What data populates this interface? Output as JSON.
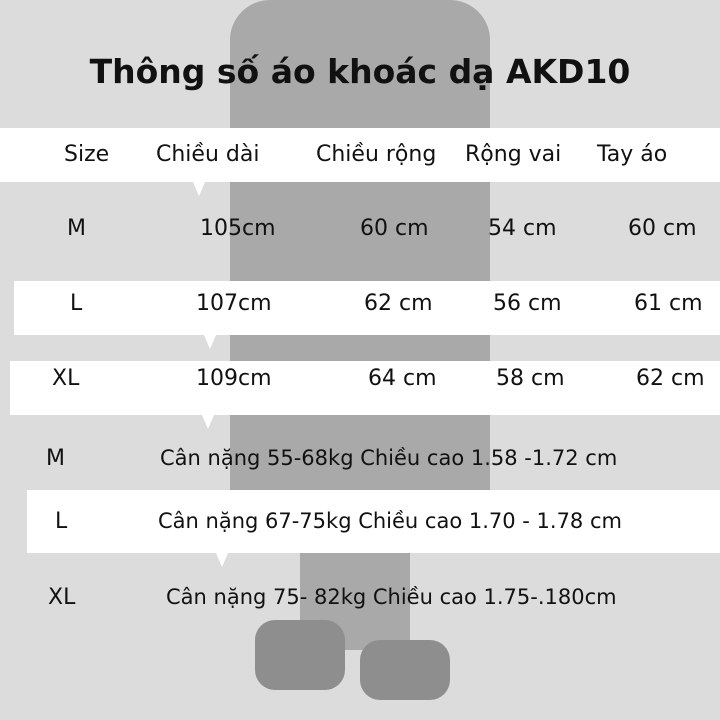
{
  "title": "Thông số áo khoác dạ AKD10",
  "headers": [
    "Size",
    "Chiều dài",
    "Chiều rộng",
    "Rộng vai",
    "Tay áo"
  ],
  "rows": [
    [
      "M",
      "105cm",
      "60 cm",
      "54 cm",
      "60 cm"
    ],
    [
      "L",
      "107cm",
      "62 cm",
      "56 cm",
      "61 cm"
    ],
    [
      "XL",
      "109cm",
      "64 cm",
      "58 cm",
      "62 cm"
    ]
  ],
  "fit": [
    {
      "size": "M",
      "text": "Cân nặng 55-68kg  Chiều cao 1.58 -1.72 cm"
    },
    {
      "size": "L",
      "text": "Cân nặng 67-75kg  Chiều cao 1.70 - 1.78 cm"
    },
    {
      "size": "XL",
      "text": "Cân nặng 75- 82kg  Chiều cao 1.75-.180cm"
    }
  ]
}
